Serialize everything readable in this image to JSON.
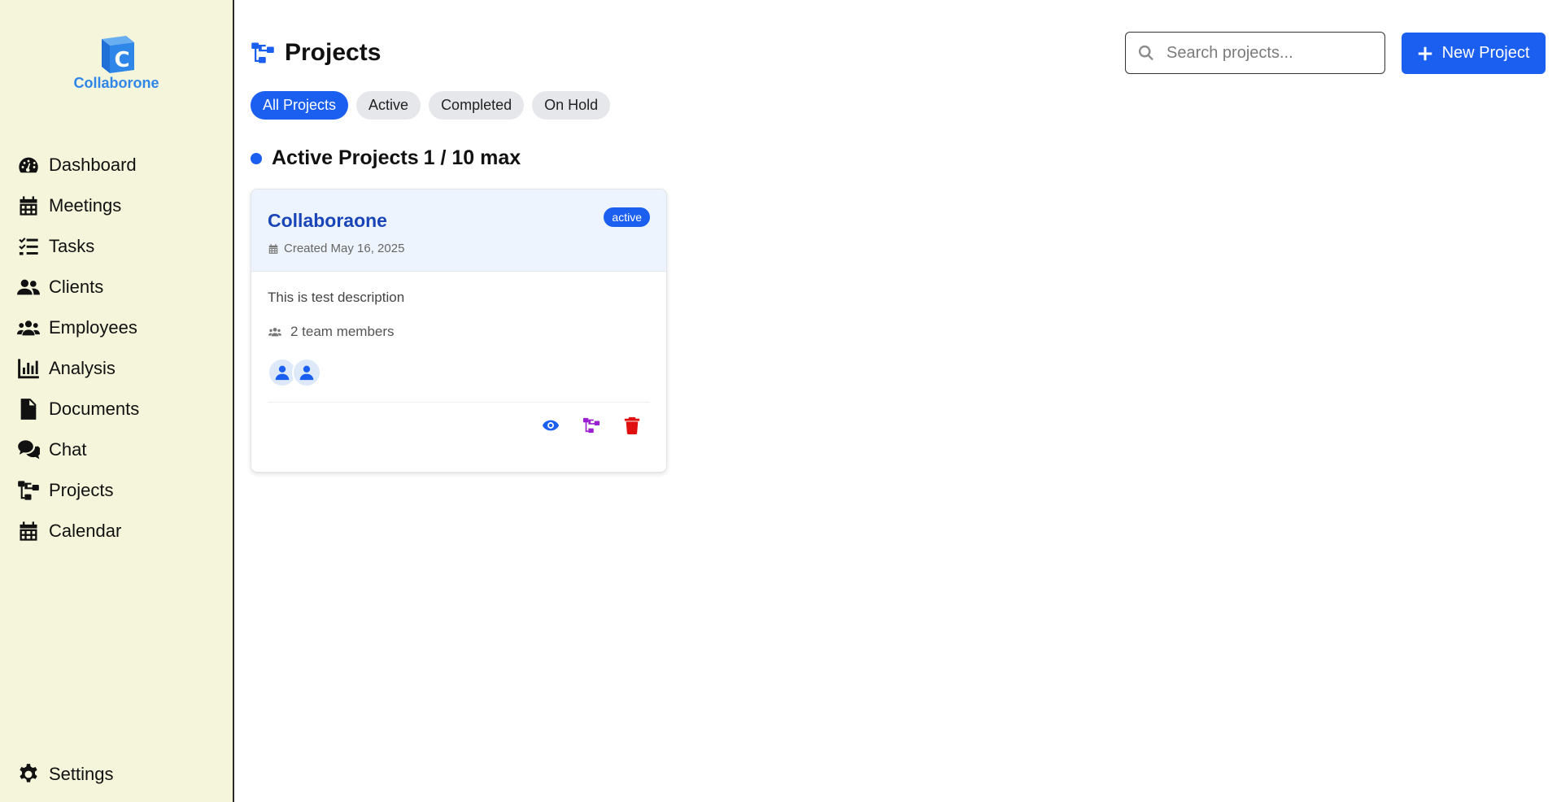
{
  "brand": {
    "name": "Collaborone",
    "logo_letter": "C",
    "color": "#2e86e8"
  },
  "sidebar": {
    "items": [
      {
        "label": "Dashboard",
        "icon": "gauge-icon"
      },
      {
        "label": "Meetings",
        "icon": "calendar-icon"
      },
      {
        "label": "Tasks",
        "icon": "tasks-icon"
      },
      {
        "label": "Clients",
        "icon": "users-icon"
      },
      {
        "label": "Employees",
        "icon": "group-icon"
      },
      {
        "label": "Analysis",
        "icon": "chart-icon"
      },
      {
        "label": "Documents",
        "icon": "document-icon"
      },
      {
        "label": "Chat",
        "icon": "chat-icon"
      },
      {
        "label": "Projects",
        "icon": "sitemap-icon"
      },
      {
        "label": "Calendar",
        "icon": "calendar-icon"
      }
    ],
    "settings_label": "Settings"
  },
  "header": {
    "title": "Projects",
    "search_placeholder": "Search projects...",
    "new_button_label": "New Project"
  },
  "filters": [
    {
      "label": "All Projects",
      "active": true
    },
    {
      "label": "Active",
      "active": false
    },
    {
      "label": "Completed",
      "active": false
    },
    {
      "label": "On Hold",
      "active": false
    }
  ],
  "section": {
    "label": "Active Projects",
    "count": "1 / 10 max"
  },
  "project_card": {
    "title": "Collaboraone",
    "status": "active",
    "created": "Created May 16, 2025",
    "description": "This is test description",
    "members_text": "2 team members",
    "avatar_count": 2
  },
  "colors": {
    "primary": "#1a5ff0",
    "sidebar_bg": "#f5f5dc",
    "view_icon": "#1a5ff0",
    "structure_icon": "#9b1fd1",
    "delete_icon": "#e01010"
  }
}
